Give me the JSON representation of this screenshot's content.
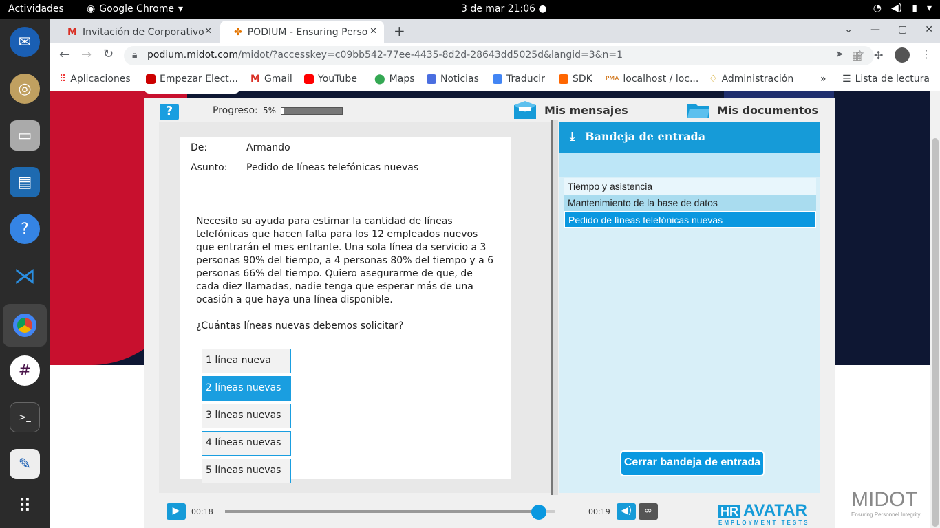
{
  "system": {
    "activities": "Actividades",
    "app_name": "Google Chrome",
    "clock": "3 de mar  21:06"
  },
  "browser": {
    "tabs": [
      {
        "label": "Invitación de Corporativo",
        "icon": "gmail-icon"
      },
      {
        "label": "PODIUM - Ensuring Perso",
        "icon": "podium-icon"
      }
    ],
    "url_host": "podium.midot.com",
    "url_path": "/midot/?accesskey=c09bb542-77ee-4435-8d2d-28643dd5025d&langid=3&n=1",
    "bookmarks": [
      "Aplicaciones",
      "Empezar Elect...",
      "Gmail",
      "YouTube",
      "Maps",
      "Noticias",
      "Traducir",
      "SDK",
      "localhost / loc...",
      "Administración"
    ],
    "more": "»",
    "reading_list": "Lista de lectura"
  },
  "header": {
    "help": "?",
    "progress_label": "Progreso:",
    "progress_value": "5%",
    "progress_fraction": 0.05,
    "messages": "Mis mensajes",
    "documents": "Mis documentos"
  },
  "message": {
    "from_label": "De:",
    "from": "Armando",
    "subject_label": "Asunto:",
    "subject": "Pedido de líneas telefónicas nuevas",
    "body": "Necesito su ayuda para estimar la cantidad de líneas telefónicas que hacen falta para los 12 empleados nuevos que entrarán el mes entrante. Una sola línea da servicio a 3 personas 90% del tiempo, a 4 personas 80% del tiempo y a 6 personas 66% del tiempo. Quiero asegurarme de que, de cada diez llamadas, nadie tenga que esperar más de una ocasión a que haya una línea disponible.",
    "question": "¿Cuántas líneas nuevas debemos solicitar?",
    "options": [
      "1 línea nueva",
      "2 líneas nuevas",
      "3 líneas nuevas",
      "4 líneas nuevas",
      "5 líneas nuevas"
    ],
    "selected_option": "2 líneas nuevas"
  },
  "inbox": {
    "title": "Bandeja de entrada",
    "items": [
      "Tiempo y asistencia",
      "Mantenimiento de la base de datos",
      "Pedido de líneas telefónicas nuevas"
    ],
    "close": "Cerrar bandeja de entrada"
  },
  "player": {
    "elapsed": "00:18",
    "total": "00:19",
    "fraction": 0.95
  },
  "branding": {
    "avatar_hr": "HR",
    "avatar": "AVATAR",
    "avatar_tag": "EMPLOYMENT TESTS",
    "midot": "MIDOT",
    "midot_tag": "Ensuring Personnel Integrity"
  }
}
